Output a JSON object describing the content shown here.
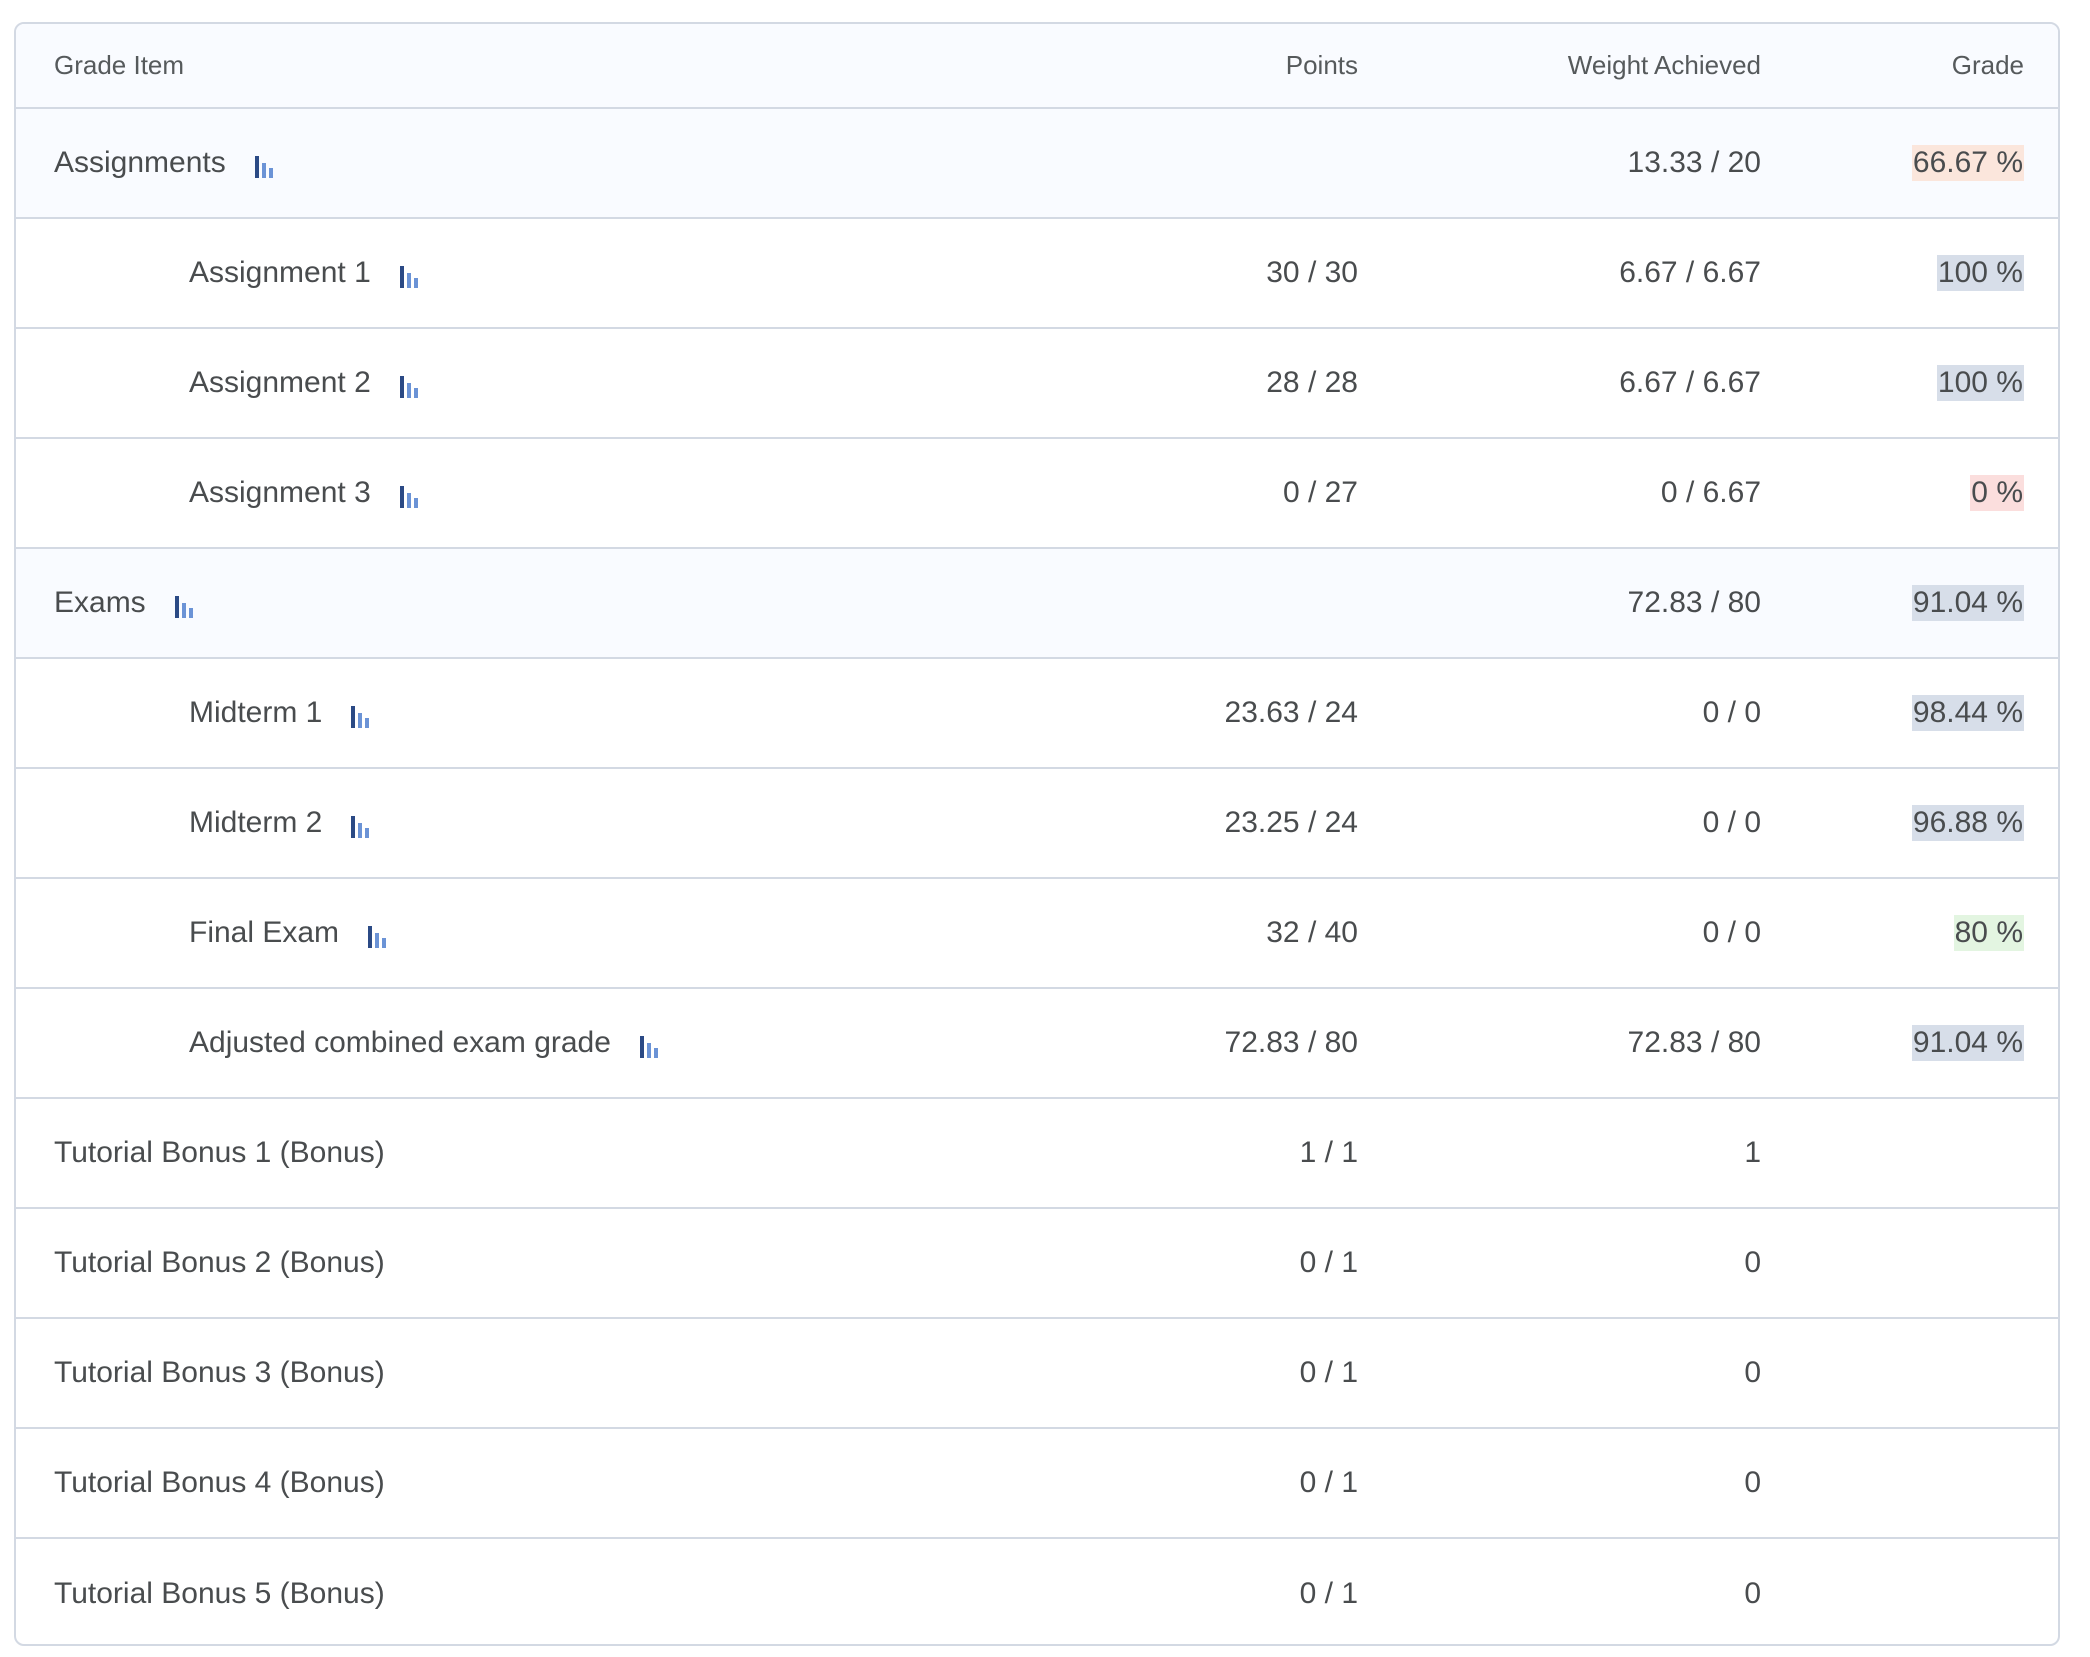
{
  "table": {
    "headers": {
      "item": "Grade Item",
      "points": "Points",
      "weight": "Weight Achieved",
      "grade": "Grade"
    },
    "rows": [
      {
        "name": "Assignments",
        "points": "",
        "weight": "13.33 / 20",
        "grade": "66.67 %",
        "grade_color": "#fbe6dc",
        "kind": "category",
        "has_stats": true
      },
      {
        "name": "Assignment 1",
        "points": "30 / 30",
        "weight": "6.67 / 6.67",
        "grade": "100 %",
        "grade_color": "#d7dee9",
        "kind": "child",
        "has_stats": true
      },
      {
        "name": "Assignment 2",
        "points": "28 / 28",
        "weight": "6.67 / 6.67",
        "grade": "100 %",
        "grade_color": "#d7dee9",
        "kind": "child",
        "has_stats": true
      },
      {
        "name": "Assignment 3",
        "points": "0 / 27",
        "weight": "0 / 6.67",
        "grade": "0 %",
        "grade_color": "#fbdedd",
        "kind": "child",
        "has_stats": true
      },
      {
        "name": "Exams",
        "points": "",
        "weight": "72.83 / 80",
        "grade": "91.04 %",
        "grade_color": "#d7dee9",
        "kind": "category",
        "has_stats": true
      },
      {
        "name": "Midterm 1",
        "points": "23.63 / 24",
        "weight": "0 / 0",
        "grade": "98.44 %",
        "grade_color": "#d7dee9",
        "kind": "child",
        "has_stats": true
      },
      {
        "name": "Midterm 2",
        "points": "23.25 / 24",
        "weight": "0 / 0",
        "grade": "96.88 %",
        "grade_color": "#d7dee9",
        "kind": "child",
        "has_stats": true
      },
      {
        "name": "Final Exam",
        "points": "32 / 40",
        "weight": "0 / 0",
        "grade": "80 %",
        "grade_color": "#e3f5e1",
        "kind": "child",
        "has_stats": true
      },
      {
        "name": "Adjusted combined exam grade",
        "points": "72.83 / 80",
        "weight": "72.83 / 80",
        "grade": "91.04 %",
        "grade_color": "#d7dee9",
        "kind": "child",
        "has_stats": true
      },
      {
        "name": "Tutorial Bonus 1 (Bonus)",
        "points": "1 / 1",
        "weight": "1",
        "grade": "",
        "grade_color": "",
        "kind": "top",
        "has_stats": false
      },
      {
        "name": "Tutorial Bonus 2 (Bonus)",
        "points": "0 / 1",
        "weight": "0",
        "grade": "",
        "grade_color": "",
        "kind": "top",
        "has_stats": false
      },
      {
        "name": "Tutorial Bonus 3 (Bonus)",
        "points": "0 / 1",
        "weight": "0",
        "grade": "",
        "grade_color": "",
        "kind": "top",
        "has_stats": false
      },
      {
        "name": "Tutorial Bonus 4 (Bonus)",
        "points": "0 / 1",
        "weight": "0",
        "grade": "",
        "grade_color": "",
        "kind": "top",
        "has_stats": false
      },
      {
        "name": "Tutorial Bonus 5 (Bonus)",
        "points": "0 / 1",
        "weight": "0",
        "grade": "",
        "grade_color": "",
        "kind": "top",
        "has_stats": false
      }
    ]
  },
  "icons": {
    "stats": "bar-chart-stats-icon"
  },
  "colors": {
    "icon_dark": "#2b4a85",
    "icon_light": "#6b93d6"
  }
}
